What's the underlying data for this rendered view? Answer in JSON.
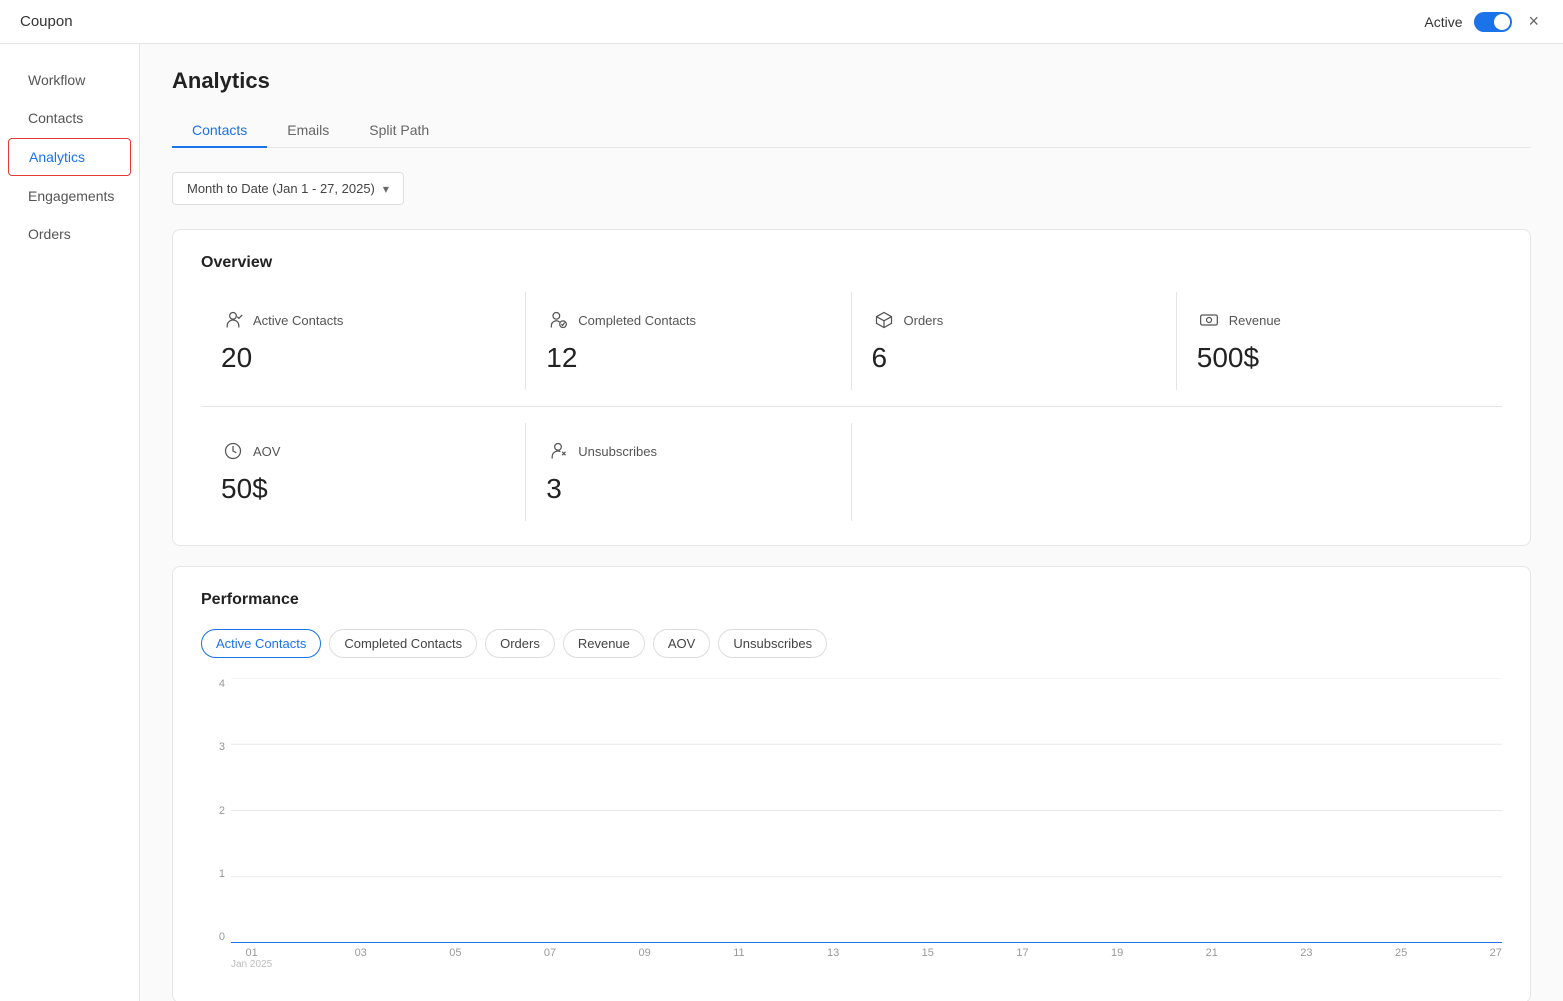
{
  "header": {
    "title": "Coupon",
    "active_label": "Active",
    "close_label": "×"
  },
  "sidebar": {
    "items": [
      {
        "id": "workflow",
        "label": "Workflow"
      },
      {
        "id": "contacts",
        "label": "Contacts"
      },
      {
        "id": "analytics",
        "label": "Analytics",
        "active": true
      },
      {
        "id": "engagements",
        "label": "Engagements"
      },
      {
        "id": "orders",
        "label": "Orders"
      }
    ]
  },
  "main": {
    "page_title": "Analytics",
    "tabs": [
      {
        "id": "contacts",
        "label": "Contacts",
        "active": true
      },
      {
        "id": "emails",
        "label": "Emails",
        "active": false
      },
      {
        "id": "split_path",
        "label": "Split Path",
        "active": false
      }
    ],
    "date_filter": {
      "label": "Month to Date (Jan 1 - 27, 2025)"
    },
    "overview": {
      "title": "Overview",
      "metrics": [
        {
          "id": "active_contacts",
          "label": "Active Contacts",
          "value": "20",
          "icon": "person-icon"
        },
        {
          "id": "completed_contacts",
          "label": "Completed Contacts",
          "value": "12",
          "icon": "check-person-icon"
        },
        {
          "id": "orders",
          "label": "Orders",
          "value": "6",
          "icon": "box-icon"
        },
        {
          "id": "revenue",
          "label": "Revenue",
          "value": "500$",
          "icon": "currency-icon"
        }
      ],
      "metrics2": [
        {
          "id": "aov",
          "label": "AOV",
          "value": "50$",
          "icon": "aov-icon"
        },
        {
          "id": "unsubscribes",
          "label": "Unsubscribes",
          "value": "3",
          "icon": "unsubscribe-icon"
        }
      ]
    },
    "performance": {
      "title": "Performance",
      "filters": [
        {
          "id": "active_contacts",
          "label": "Active Contacts",
          "active": true
        },
        {
          "id": "completed_contacts",
          "label": "Completed Contacts",
          "active": false
        },
        {
          "id": "orders",
          "label": "Orders",
          "active": false
        },
        {
          "id": "revenue",
          "label": "Revenue",
          "active": false
        },
        {
          "id": "aov",
          "label": "AOV",
          "active": false
        },
        {
          "id": "unsubscribes",
          "label": "Unsubscribes",
          "active": false
        }
      ],
      "chart": {
        "y_labels": [
          "4",
          "3",
          "2",
          "1",
          "0"
        ],
        "x_labels": [
          {
            "date": "01",
            "sub": "Jan 2025"
          },
          {
            "date": "03",
            "sub": ""
          },
          {
            "date": "05",
            "sub": ""
          },
          {
            "date": "07",
            "sub": ""
          },
          {
            "date": "09",
            "sub": ""
          },
          {
            "date": "11",
            "sub": ""
          },
          {
            "date": "13",
            "sub": ""
          },
          {
            "date": "15",
            "sub": ""
          },
          {
            "date": "17",
            "sub": ""
          },
          {
            "date": "19",
            "sub": ""
          },
          {
            "date": "21",
            "sub": ""
          },
          {
            "date": "23",
            "sub": ""
          },
          {
            "date": "25",
            "sub": ""
          },
          {
            "date": "27",
            "sub": ""
          }
        ]
      }
    }
  }
}
